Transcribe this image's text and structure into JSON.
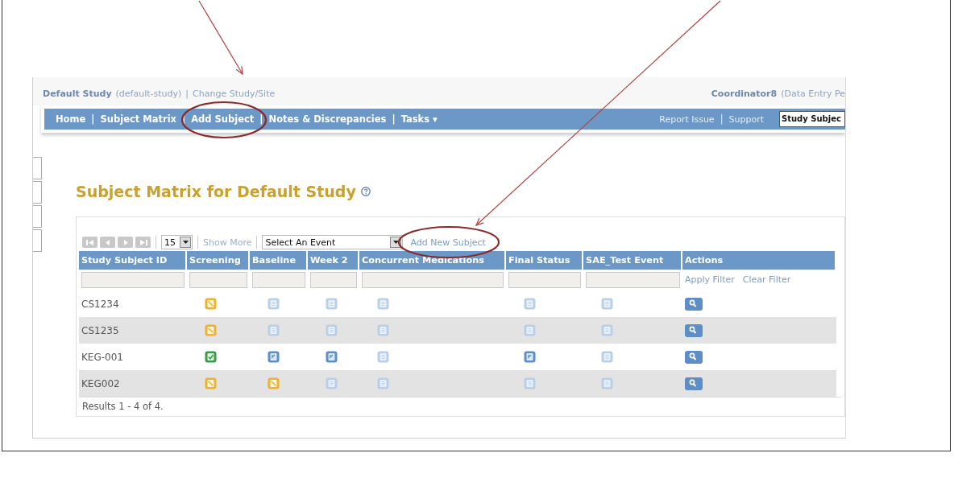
{
  "study_bar": {
    "study": "Default Study",
    "study_id": "(default-study)",
    "separator": "|",
    "change_link": "Change Study/Site",
    "user": "Coordinator8",
    "role": "(Data Entry Pe"
  },
  "nav": {
    "items": [
      {
        "label": "Home",
        "selected": false
      },
      {
        "label": "Subject Matrix",
        "selected": false
      },
      {
        "label": "Add Subject",
        "selected": false
      },
      {
        "label": "Notes & Discrepancies",
        "selected": false
      },
      {
        "label": "Tasks ▾",
        "selected": false
      }
    ],
    "separator": "|",
    "links": [
      "Report Issue",
      "Support"
    ],
    "links_separator": "|",
    "search": {
      "value": "Study Subjec"
    }
  },
  "page_title": "Subject Matrix for Default Study",
  "toolbar": {
    "page_size": "15",
    "show_more": "Show More",
    "event_select": "Select An Event",
    "add_link": "Add New Subject"
  },
  "table": {
    "columns": [
      "Study Subject ID",
      "Screening",
      "Baseline",
      "Week 2",
      "Concurrent Medications",
      "Final Status",
      "SAE_Test Event",
      "Actions"
    ],
    "filter_links": [
      "Apply Filter",
      "Clear Filter"
    ],
    "rows": [
      {
        "id": "CS1234",
        "events": [
          {
            "kind": "scheduled"
          },
          {
            "kind": "not_scheduled"
          },
          {
            "kind": "not_scheduled"
          },
          {
            "kind": "not_scheduled"
          },
          {
            "kind": "not_scheduled"
          },
          {
            "kind": "not_scheduled"
          }
        ]
      },
      {
        "id": "CS1235",
        "events": [
          {
            "kind": "scheduled"
          },
          {
            "kind": "not_scheduled"
          },
          {
            "kind": "not_scheduled"
          },
          {
            "kind": "not_scheduled"
          },
          {
            "kind": "not_scheduled"
          },
          {
            "kind": "not_scheduled"
          }
        ]
      },
      {
        "id": "KEG-001",
        "events": [
          {
            "kind": "completed"
          },
          {
            "kind": "started"
          },
          {
            "kind": "started"
          },
          {
            "kind": "not_scheduled"
          },
          {
            "kind": "started"
          },
          {
            "kind": "not_scheduled"
          }
        ]
      },
      {
        "id": "KEG002",
        "events": [
          {
            "kind": "scheduled"
          },
          {
            "kind": "scheduled"
          },
          {
            "kind": "not_scheduled"
          },
          {
            "kind": "not_scheduled"
          },
          {
            "kind": "not_scheduled"
          },
          {
            "kind": "not_scheduled"
          }
        ]
      }
    ],
    "footer": "Results 1 - 4 of 4."
  }
}
